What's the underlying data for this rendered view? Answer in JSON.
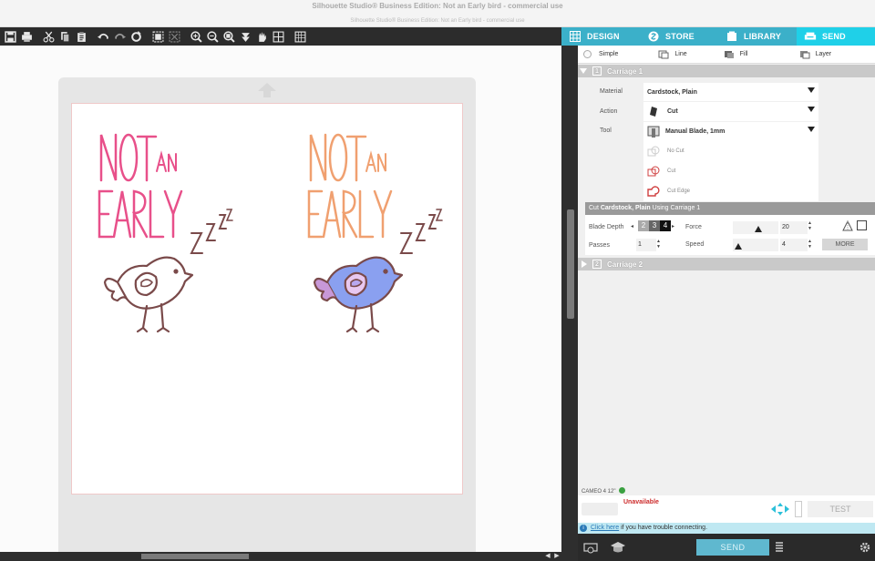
{
  "window": {
    "title": "Silhouette Studio® Business Edition: Not an Early bird - commercial use",
    "subtitle": "Silhouette Studio® Business Edition: Not an Early bird - commercial use"
  },
  "tabs": [
    {
      "label": "DESIGN",
      "icon": "grid-icon"
    },
    {
      "label": "STORE",
      "icon": "store-icon"
    },
    {
      "label": "LIBRARY",
      "icon": "library-icon"
    },
    {
      "label": "SEND",
      "icon": "send-icon",
      "active": true
    }
  ],
  "modes": {
    "simple": "Simple",
    "line": "Line",
    "fill": "Fill",
    "layer": "Layer"
  },
  "carriage1": {
    "num": "1",
    "label": "Carriage 1"
  },
  "carriage2": {
    "num": "2",
    "label": "Carriage 2"
  },
  "material": {
    "label": "Material",
    "value": "Cardstock, Plain"
  },
  "action": {
    "label": "Action",
    "value": "Cut"
  },
  "tool": {
    "label": "Tool",
    "value": "Manual Blade, 1mm"
  },
  "cut_options": [
    "No Cut",
    "Cut",
    "Cut Edge"
  ],
  "cut_settings": {
    "prefix": "Cut ",
    "material": "Cardstock, Plain",
    "suffix": " Using Carriage 1"
  },
  "blade_depth": {
    "label": "Blade Depth",
    "digits": [
      "2",
      "3",
      "4"
    ]
  },
  "force": {
    "label": "Force",
    "value": "20"
  },
  "passes": {
    "label": "Passes",
    "value": "1"
  },
  "speed": {
    "label": "Speed",
    "value": "4"
  },
  "more_label": "MORE",
  "machine": {
    "name": "CAMEO 4 12\"",
    "status": "Unavailable",
    "test_label": "TEST"
  },
  "info": {
    "link": "Click here",
    "text": " if you have trouble connecting."
  },
  "send_label": "SEND",
  "artwork": {
    "word1": "NOT",
    "word2": "AN",
    "word3": "EARLY",
    "zzz": "Z",
    "colors": {
      "left_text": "#e8508a",
      "right_text": "#f0a070",
      "bird_outline": "#7a4a4a",
      "bird_fill": "#8aa0f0",
      "wing": "#e8a0d0"
    }
  },
  "colors": {
    "accent": "#29c4df",
    "toolbar": "#2c2c2c",
    "unavailable": "#cc2a2a"
  }
}
